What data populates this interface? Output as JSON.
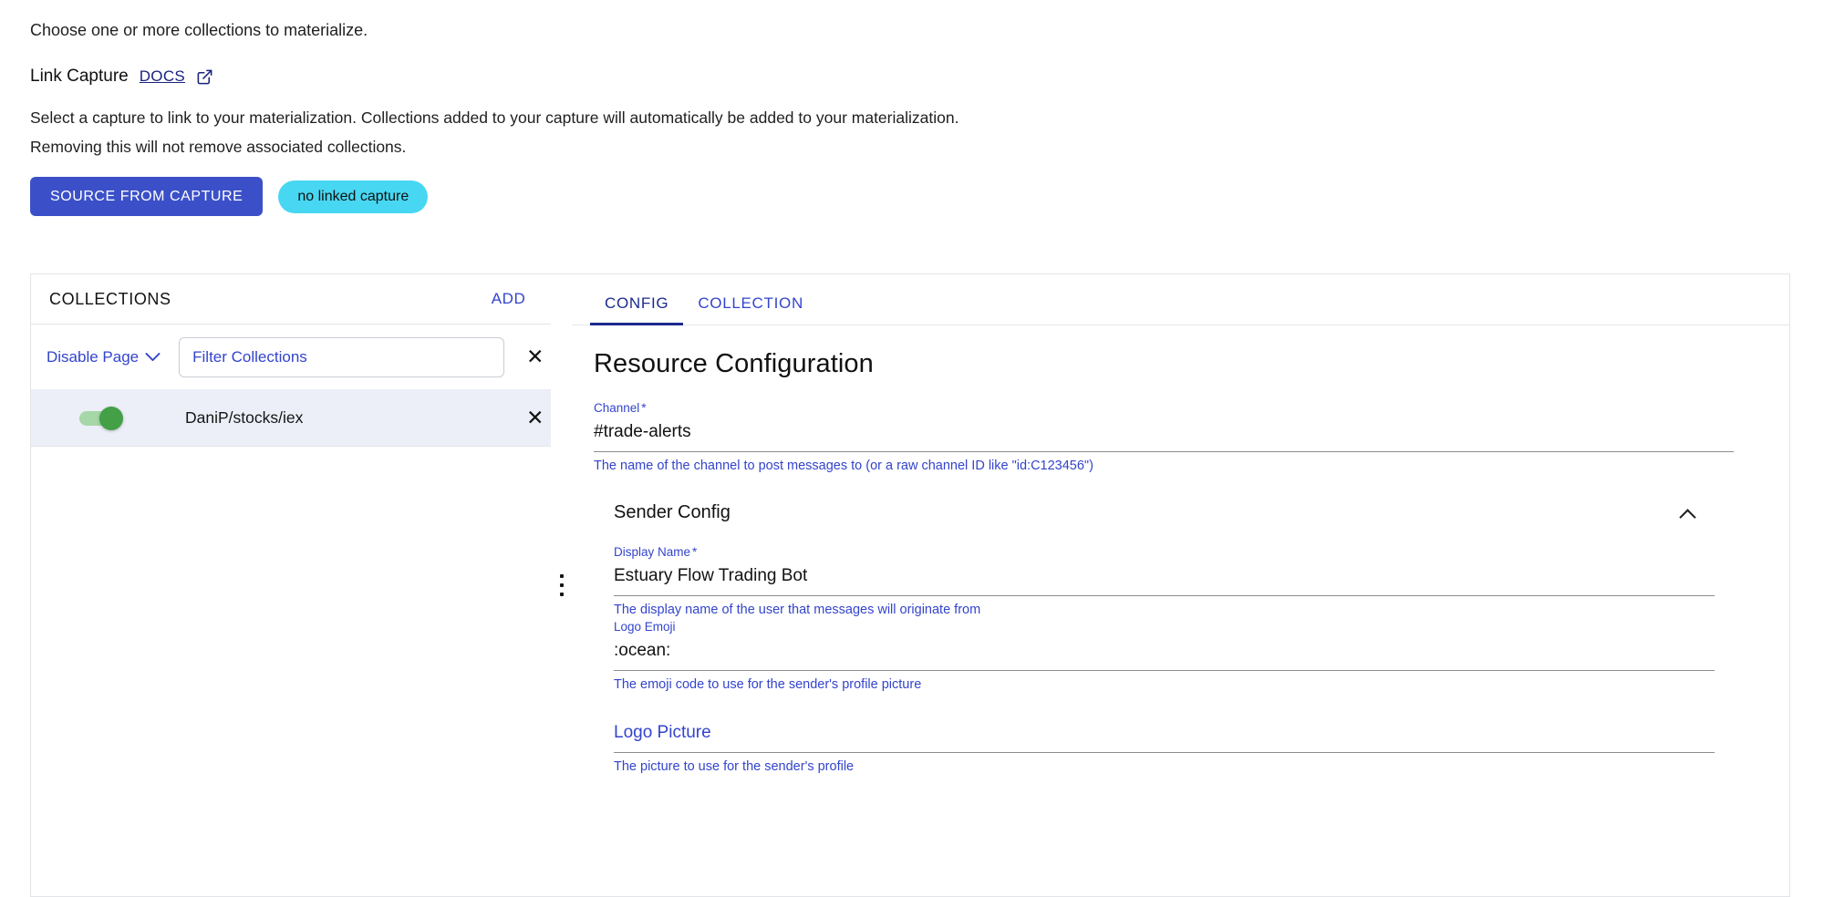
{
  "intro": {
    "choose_text": "Choose one or more collections to materialize.",
    "link_capture_title": "Link Capture",
    "docs_label": "DOCS",
    "docs_icon": "external-link-icon",
    "description_line1": "Select a capture to link to your materialization. Collections added to your capture will automatically be added to your materialization.",
    "description_line2": "Removing this will not remove associated collections.",
    "source_button_label": "SOURCE FROM CAPTURE",
    "linked_capture_chip": "no linked capture",
    "source_button_color": "#3b50c8",
    "chip_color": "#47d7f2"
  },
  "collections_panel": {
    "header_title": "COLLECTIONS",
    "add_label": "ADD",
    "disable_page_label": "Disable Page",
    "disable_page_icon": "chevron-down-icon",
    "filter_placeholder": "Filter Collections",
    "filter_value": "",
    "clear_filter_icon": "close-icon",
    "rows": [
      {
        "name": "DaniP/stocks/iex",
        "enabled": true,
        "toggle_on_color": "#43a047",
        "remove_icon": "close-icon"
      }
    ]
  },
  "divider": {
    "handle_icon": "drag-handle-dots-icon"
  },
  "config_panel": {
    "tabs": [
      {
        "label": "CONFIG",
        "active": true
      },
      {
        "label": "COLLECTION",
        "active": false
      }
    ],
    "title": "Resource Configuration",
    "channel_field": {
      "label": "Channel",
      "required_marker": "*",
      "value": "#trade-alerts",
      "help": "The name of the channel to post messages to (or a raw channel ID like \"id:C123456\")"
    },
    "sender_config": {
      "section_title": "Sender Config",
      "collapse_icon": "chevron-up-icon",
      "expanded": true,
      "display_name": {
        "label": "Display Name",
        "required_marker": "*",
        "value": "Estuary Flow Trading Bot",
        "help": "The display name of the user that messages will originate from"
      },
      "logo_emoji": {
        "label": "Logo Emoji",
        "value": ":ocean:",
        "help": "The emoji code to use for the sender's profile picture"
      },
      "logo_picture": {
        "label": "Logo Picture",
        "placeholder": "Logo Picture",
        "value": "",
        "help": "The picture to use for the sender's profile"
      }
    }
  }
}
